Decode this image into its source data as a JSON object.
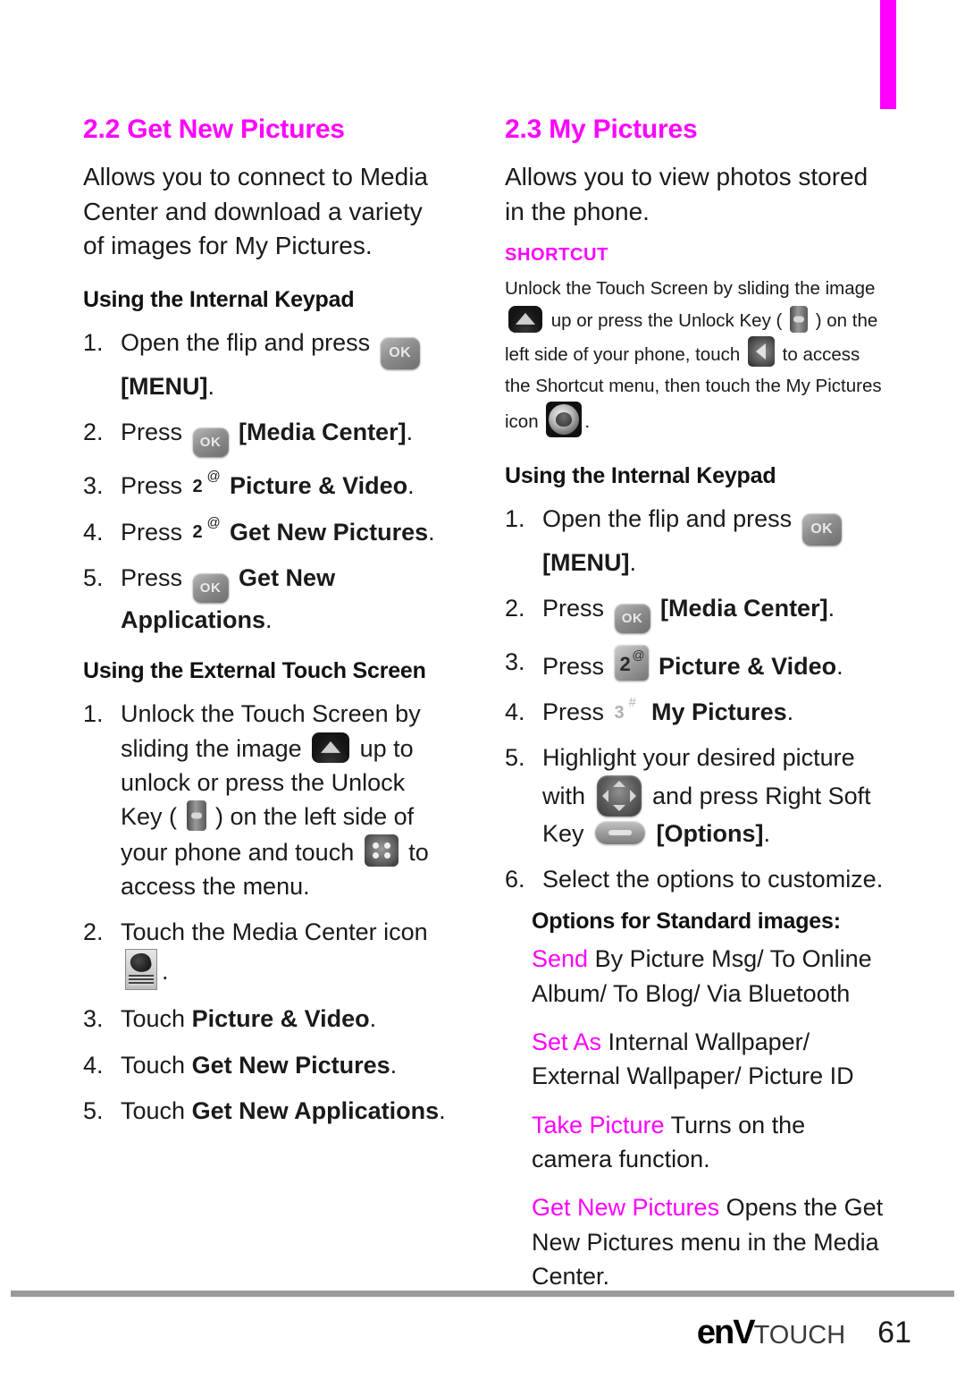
{
  "colors": {
    "accent": "#ff00ff",
    "text": "#1a1a1a",
    "rule": "#9a9a9a"
  },
  "left_column": {
    "section_title": "2.2 Get New Pictures",
    "intro": "Allows you to connect to Media Center and download a variety of images for My Pictures.",
    "internal_keypad": {
      "heading": "Using the Internal Keypad",
      "steps": [
        {
          "number": "1.",
          "pre": "Open the flip and press ",
          "icon": "ok-key",
          "post": "",
          "bold_tail": "[MENU]",
          "tail": "."
        },
        {
          "number": "2.",
          "pre": "Press ",
          "icon": "ok-key",
          "post": " ",
          "bold_tail": "[Media Center]",
          "tail": "."
        },
        {
          "number": "3.",
          "pre": "Press ",
          "icon": "key-2-at-plain",
          "post": " ",
          "bold_tail": "Picture & Video",
          "tail": "."
        },
        {
          "number": "4.",
          "pre": "Press ",
          "icon": "key-2-at-plain",
          "post": " ",
          "bold_tail": "Get New Pictures",
          "tail": "."
        },
        {
          "number": "5.",
          "pre": "Press ",
          "icon": "ok-key",
          "post": " ",
          "bold_tail": "Get New Applications",
          "tail": "."
        }
      ]
    },
    "external_touch": {
      "heading": "Using the External Touch Screen",
      "steps": [
        {
          "number": "1.",
          "part1": "Unlock the Touch Screen by sliding the image ",
          "icon1": "slide-up-icon",
          "part2": " up to unlock or press the Unlock Key ( ",
          "icon2": "unlock-key-icon",
          "part3": " ) on the left side of your phone and touch ",
          "icon3": "menu-dots-icon",
          "part4": " to access the menu."
        },
        {
          "number": "2.",
          "part1": "Touch the Media Center icon ",
          "icon1": "media-center-icon",
          "part2": "."
        },
        {
          "number": "3.",
          "pre": "Touch ",
          "bold_tail": "Picture & Video",
          "tail": "."
        },
        {
          "number": "4.",
          "pre": "Touch ",
          "bold_tail": "Get New Pictures",
          "tail": "."
        },
        {
          "number": "5.",
          "pre": "Touch ",
          "bold_tail": "Get New Applications",
          "tail": "."
        }
      ]
    }
  },
  "right_column": {
    "section_title": "2.3 My Pictures",
    "intro": "Allows you to view photos stored in the phone.",
    "shortcut": {
      "label": "SHORTCUT",
      "part1": "Unlock the Touch Screen by sliding the image ",
      "icon1": "slide-up-icon",
      "part2": " up or press the Unlock Key ( ",
      "icon2": "unlock-key-icon",
      "part3": " ) on the left side of your phone, touch ",
      "icon3": "shortcut-arrow-icon",
      "part4": " to access the Shortcut menu, then touch the My Pictures icon ",
      "icon4": "my-pictures-icon",
      "part5": "."
    },
    "internal_keypad": {
      "heading": "Using the Internal Keypad",
      "steps": [
        {
          "number": "1.",
          "pre": "Open the flip and press ",
          "icon": "ok-key",
          "bold_tail": "[MENU]",
          "tail": "."
        },
        {
          "number": "2.",
          "pre": "Press ",
          "icon": "ok-key",
          "post": " ",
          "bold_tail": "[Media Center]",
          "tail": "."
        },
        {
          "number": "3.",
          "pre": "Press ",
          "icon": "key-2-at",
          "post": " ",
          "bold_tail": "Picture & Video",
          "tail": "."
        },
        {
          "number": "4.",
          "pre": "Press ",
          "icon": "key-3-hash-plain",
          "post": " ",
          "bold_tail": "My Pictures",
          "tail": "."
        },
        {
          "number": "5.",
          "part1": "Highlight your desired picture with ",
          "icon1": "nav-key-icon",
          "part2": " and press Right Soft Key ",
          "icon2": "soft-key-icon",
          "part3": " ",
          "bold_tail": "[Options]",
          "tail": "."
        },
        {
          "number": "6.",
          "plain": "Select the options to customize."
        }
      ]
    },
    "options": {
      "heading": "Options for Standard images:",
      "items": [
        {
          "key": "Send",
          "desc": " By Picture Msg/ To Online Album/ To Blog/ Via Bluetooth"
        },
        {
          "key": "Set As",
          "desc": " Internal Wallpaper/ External Wallpaper/ Picture ID"
        },
        {
          "key": "Take Picture",
          "desc": "  Turns on the camera function."
        },
        {
          "key": "Get New Pictures",
          "desc": "  Opens the Get New Pictures menu in the Media Center."
        }
      ]
    }
  },
  "footer": {
    "logo_env": "enV",
    "logo_touch": "TOUCH",
    "page_number": "61"
  }
}
